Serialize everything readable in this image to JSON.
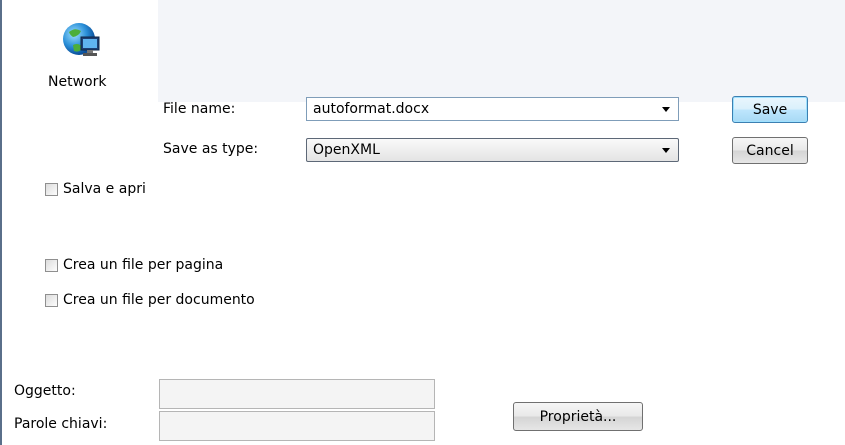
{
  "places": {
    "network_label": "Network"
  },
  "form": {
    "file_name_label": "File name:",
    "file_name_value": "autoformat.docx",
    "save_type_label": "Save as type:",
    "save_type_value": "OpenXML"
  },
  "buttons": {
    "save": "Save",
    "cancel": "Cancel",
    "properties": "Proprietà..."
  },
  "options": {
    "salva_e_apri": "Salva e apri",
    "crea_per_pagina": "Crea un file per pagina",
    "crea_per_documento": "Crea un file per documento"
  },
  "metadata": {
    "oggetto_label": "Oggetto:",
    "parole_label": "Parole chiavi:",
    "oggetto_value": "",
    "parole_value": ""
  },
  "icons": {
    "network": "network-globe-icon",
    "combo_arrow": "chevron-down-icon"
  },
  "colors": {
    "window_border": "#5a6f8a",
    "strip_bg": "#f3f5f9",
    "default_button_border": "#3c7fb1"
  }
}
